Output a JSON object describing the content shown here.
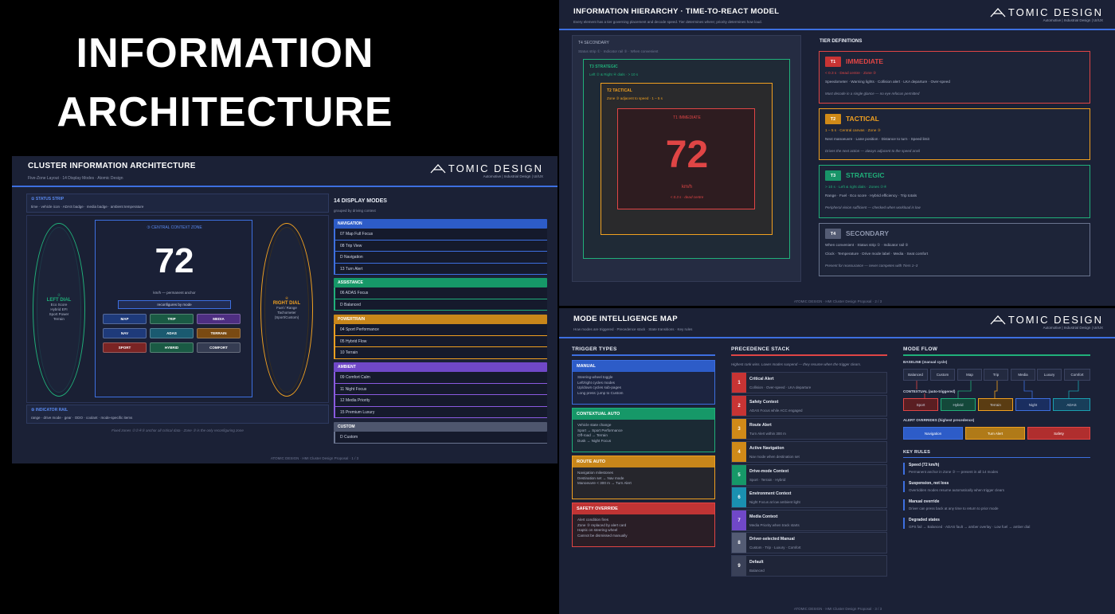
{
  "hero": {
    "line1": "INFORMATION",
    "line2": "ARCHITECTURE"
  },
  "logo": {
    "text": "TOMIC DESIGN",
    "sub": "Automotive | Industrial Design | UI/UX"
  },
  "colors": {
    "blue": "#3d6fe0",
    "red": "#e04545",
    "amber": "#f0a020",
    "green": "#20b07a",
    "slate": "#6a748f",
    "purple": "#8a5ae0",
    "teal": "#1aa0b0"
  },
  "slide1": {
    "title": "CLUSTER INFORMATION ARCHITECTURE",
    "subtitle": "Five-Zone Layout  ·  14 Display Modes  ·  Atomic Design",
    "status_strip": {
      "label": "① STATUS STRIP",
      "items": "time  ·  vehicle icon  ·  ADAS badge  ·  media badge  ·  ambient temperature"
    },
    "left_dial": {
      "num": "②",
      "label": "LEFT DIAL",
      "desc": "Eco Score\nHybrid EFI\nSport Power\nTerrain"
    },
    "right_dial": {
      "num": "④",
      "label": "RIGHT DIAL",
      "desc": "Fuel / Range\nTachometer\n(Sport/Custom)"
    },
    "center": {
      "label": "③  CENTRAL CONTEXT ZONE",
      "speed": "72",
      "unit": "km/h  —  permanent anchor",
      "reconfig": "reconfigures by mode"
    },
    "modes": [
      "MAP",
      "TRIP",
      "MEDIA",
      "NAV",
      "ADAS",
      "TERRAIN",
      "SPORT",
      "HYBRID",
      "COMFORT"
    ],
    "indicator_rail": {
      "label": "⑤ INDICATOR RAIL",
      "items": "range  ·  drive mode  ·  gear  ·  ODO  ·  coolant  ·  mode-specific items"
    },
    "fixed_note": "Fixed zones ①②④⑤ anchor all critical data  ·  Zone ③ is the only reconfiguring zone",
    "display_modes": {
      "title": "14 DISPLAY MODES",
      "sub": "grouped by driving context",
      "groups": [
        {
          "name": "NAVIGATION",
          "items": [
            "07  Map Full Focus",
            "08  Trip View",
            "D  Navigation",
            "13  Turn Alert"
          ]
        },
        {
          "name": "ASSISTANCE",
          "items": [
            "06  ADAS Focus",
            "D  Balanced"
          ]
        },
        {
          "name": "POWERTRAIN",
          "items": [
            "04  Sport Performance",
            "05  Hybrid Flow",
            "10  Terrain"
          ]
        },
        {
          "name": "AMBIENT",
          "items": [
            "09  Comfort Calm",
            "11  Night Focus",
            "12  Media Priority",
            "15  Premium Luxury"
          ]
        },
        {
          "name": "CUSTOM",
          "items": [
            "D  Custom"
          ]
        }
      ]
    },
    "footer": "ATOMIC DESIGN  ·  HMI Cluster Design Proposal  ·  1 / 3"
  },
  "slide2": {
    "title": "INFORMATION HIERARCHY  ·  TIME-TO-REACT MODEL",
    "subtitle": "Every element has a tier governing placement and decode speed. Tier determines where; priority determines how loud.",
    "t4": {
      "label": "T4  SECONDARY",
      "desc": "Status strip ①  ·  Indicator rail ⑤  ·  When convenient"
    },
    "t3": {
      "label": "T3  STRATEGIC",
      "desc": "Left ② & Right ④ dials  ·  > 10 s"
    },
    "t2": {
      "label": "T2  TACTICAL",
      "desc": "Zone ③ adjacent to speed  ·  1 – 5 s"
    },
    "t1": {
      "label": "T1  IMMEDIATE",
      "speed": "72",
      "unit": "km/h",
      "desc": "< 0.3 s  ·  dead centre"
    },
    "defs_title": "TIER DEFINITIONS",
    "tiers": [
      {
        "badge": "T1",
        "name": "IMMEDIATE",
        "l1": "< 0.3 s  ·  Dead centre  ·  Zone ③",
        "l2": "Speedometer  ·  Warning lights  ·  Collision alert  ·  LKA departure  ·  Over-speed",
        "l3": "Must decode in a single glance — no eye refocus permitted"
      },
      {
        "badge": "T2",
        "name": "TACTICAL",
        "l1": "1 – 5 s  ·  Central canvas  ·  Zone ③",
        "l2": "Next manoeuvre  ·  Lane position  ·  Distance to turn  ·  Speed limit",
        "l3": "Drives the next action — always adjacent to the speed anvil"
      },
      {
        "badge": "T3",
        "name": "STRATEGIC",
        "l1": "> 10 s  ·  Left & right dials  ·  Zones ②④",
        "l2": "Range  ·  Fuel  ·  Eco score  ·  Hybrid efficiency  ·  Trip totals",
        "l3": "Peripheral vision sufficient — checked when workload is low"
      },
      {
        "badge": "T4",
        "name": "SECONDARY",
        "l1": "When convenient  ·  Status strip ①  ·  Indicator rail ⑤",
        "l2": "Clock  ·  Temperature  ·  Drive mode label  ·  Media  ·  Seat comfort",
        "l3": "Present for reassurance — never competes with Tiers 1–3"
      }
    ],
    "footer": "ATOMIC DESIGN  ·  HMI Cluster Design Proposal  ·  2 / 3"
  },
  "slide3": {
    "title": "MODE INTELLIGENCE MAP",
    "subtitle": "How modes are triggered  ·  Precedence stack  ·  State transitions  ·  Key rules",
    "trigger_title": "TRIGGER TYPES",
    "triggers": [
      {
        "name": "MANUAL",
        "body": "Steering-wheel toggle\nLeft/right cycles modes\nUp/down cycles sub-pages\nLong press: jump to Custom"
      },
      {
        "name": "CONTEXTUAL AUTO",
        "body": "Vehicle state change\nSport → Sport Performance\nOff-road → Terrain\nDusk → Night Focus"
      },
      {
        "name": "ROUTE AUTO",
        "body": "Navigation milestones\nDestination set → Nav mode\nManoeuvre < 300 m → Turn Alert"
      },
      {
        "name": "SAFETY OVERRIDE",
        "body": "Alert condition fires\nZone ③ replaced by alert card\nHaptic on steering wheel\nCannot be dismissed manually"
      }
    ],
    "prec_title": "PRECEDENCE STACK",
    "prec_sub": "Highest rank wins. Lower modes suspend — they resume when the trigger clears.",
    "stack": [
      {
        "n": "1",
        "t": "Critical Alert",
        "d": "Collision  ·  Over-speed  ·  LKA departure"
      },
      {
        "n": "2",
        "t": "Safety Context",
        "d": "ADAS Focus while ACC engaged"
      },
      {
        "n": "3",
        "t": "Route Alert",
        "d": "Turn Alert within 300 m"
      },
      {
        "n": "4",
        "t": "Active Navigation",
        "d": "Nav mode when destination set"
      },
      {
        "n": "5",
        "t": "Drive-mode Context",
        "d": "Sport  ·  Terrain  ·  Hybrid"
      },
      {
        "n": "6",
        "t": "Environment Context",
        "d": "Night Focus at low ambient light"
      },
      {
        "n": "7",
        "t": "Media Context",
        "d": "Media Priority when track starts"
      },
      {
        "n": "8",
        "t": "Driver-selected Manual",
        "d": "Custom  ·  Trip  ·  Luxury  ·  Comfort"
      },
      {
        "n": "9",
        "t": "Default",
        "d": "Balanced"
      }
    ],
    "flow_title": "MODE FLOW",
    "baseline": "BASELINE  (manual cycle)",
    "baseline_modes": [
      "Balanced",
      "Custom",
      "Map",
      "Trip",
      "Media",
      "Luxury",
      "Comfort"
    ],
    "contextual": "CONTEXTUAL (auto-triggered)",
    "contextual_modes": [
      "Sport",
      "Hybrid",
      "Terrain",
      "Night",
      "ADAS"
    ],
    "overrides": "ALERT OVERRIDES  (highest precedence)",
    "override_modes": [
      "Navigation",
      "Turn Alert",
      "Safety"
    ],
    "rules_title": "KEY RULES",
    "rules": [
      {
        "t": "Speed (72 km/h)",
        "d": "Permanent anchor in Zone ③ — present in all 14 modes"
      },
      {
        "t": "Suspension, not loss",
        "d": "Overridden modes resume automatically when trigger clears"
      },
      {
        "t": "Manual override",
        "d": "Driver can press back at any time to return to prior mode"
      },
      {
        "t": "Degraded states",
        "d": "GPS fail → Balanced  ·  ADAS fault → amber overlay  ·  Low fuel → amber dial"
      }
    ],
    "footer": "ATOMIC DESIGN  ·  HMI Cluster Design Proposal  ·  3 / 3"
  }
}
